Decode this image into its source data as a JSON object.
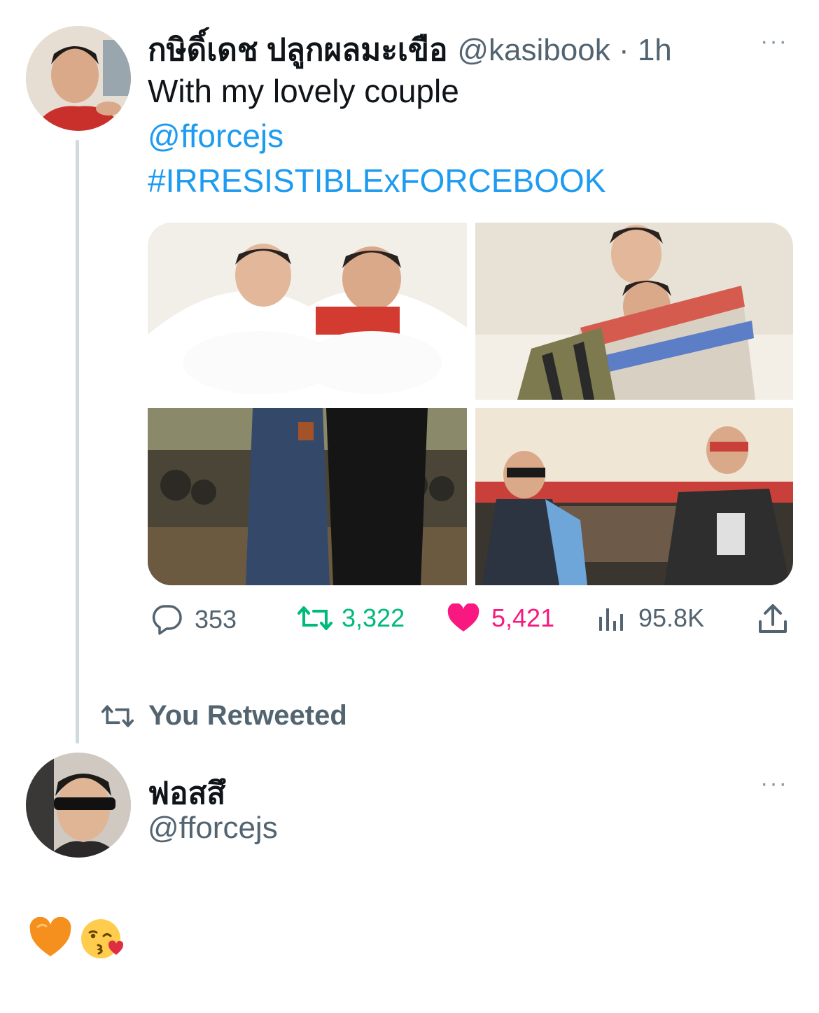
{
  "tweet1": {
    "display_name": "กษิดิ์เดช ปลูกผลมะเขือ",
    "handle_time": "@kasibook · 1h",
    "more_label": "···",
    "avatar_icon": "user-avatar-icon",
    "lines": {
      "text": "With my lovely couple",
      "mention": "@fforcejs",
      "hashtag": "#IRRESISTIBLExFORCEBOOK"
    },
    "media_count": 4,
    "stats": {
      "replies": "353",
      "retweets": "3,322",
      "likes": "5,421",
      "views": "95.8K"
    }
  },
  "retweet_banner": {
    "label": "You Retweeted"
  },
  "tweet2": {
    "display_name": "ฟอสสึ",
    "handle": "@fforcejs",
    "more_label": "···",
    "body_emojis": [
      "orange-heart-icon",
      "kissing-face-icon"
    ]
  },
  "colors": {
    "link": "#1d9bf0",
    "retweet_green": "#00ba7c",
    "like_pink": "#f91880",
    "muted": "#536471"
  }
}
